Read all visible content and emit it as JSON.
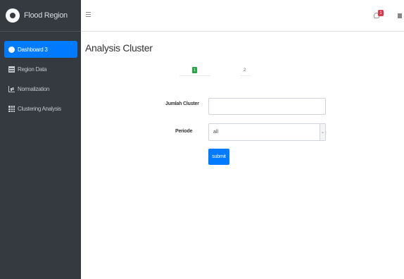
{
  "brand": {
    "name": "Flood Region"
  },
  "sidebar": {
    "items": [
      {
        "label": "Dashboard 3",
        "icon": "dashboard-icon",
        "active": true
      },
      {
        "label": "Region Data",
        "icon": "table-icon"
      },
      {
        "label": "Normalization",
        "icon": "chart-icon"
      },
      {
        "label": "Clustering Analysis",
        "icon": "grid-icon"
      }
    ]
  },
  "topbar": {
    "menu_icon": "hamburger-icon",
    "notification_count": "1",
    "notification_icon": "bell-icon",
    "apps_icon": "apps-icon"
  },
  "main": {
    "title": "Analysis Cluster",
    "steps": [
      {
        "number": "1",
        "status": "done"
      },
      {
        "number": "2",
        "status": "pending"
      }
    ],
    "form": {
      "jumlah_label": "Jumlah Cluster",
      "jumlah_value": "",
      "periode_label": "Periode",
      "periode_value": "all",
      "submit_label": "submit"
    }
  },
  "colors": {
    "sidebar_bg": "#343a40",
    "active_item": "#007bff",
    "step_done": "#28a745",
    "badge": "#dc3545",
    "submit": "#007bff"
  }
}
